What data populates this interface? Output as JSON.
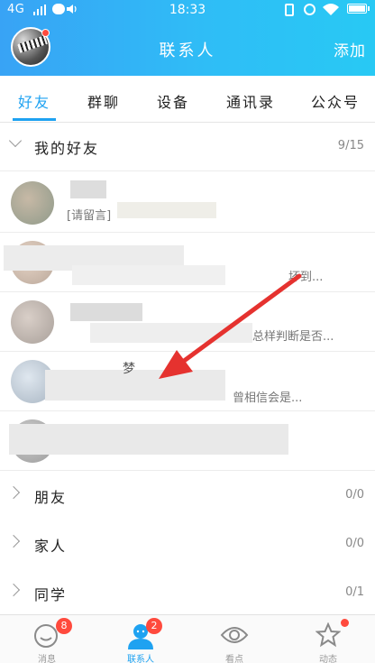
{
  "status_bar": {
    "network": "4G",
    "time": "18:33"
  },
  "header": {
    "title": "联系人",
    "add_label": "添加"
  },
  "tabs": [
    {
      "label": "好友",
      "active": true
    },
    {
      "label": "群聊"
    },
    {
      "label": "设备"
    },
    {
      "label": "通讯录"
    },
    {
      "label": "公众号"
    }
  ],
  "groups": [
    {
      "name": "我的好友",
      "count": "9/15",
      "expanded": true
    },
    {
      "name": "朋友",
      "count": "0/0"
    },
    {
      "name": "家人",
      "count": "0/0"
    },
    {
      "name": "同学",
      "count": "0/1"
    }
  ],
  "friends": [
    {
      "signature": "[请留言]"
    },
    {
      "signature": "坏到..."
    },
    {
      "signature": "总样判断是否..."
    },
    {
      "name_fragment": "梦",
      "signature": "曾相信会是..."
    },
    {
      "signature": ""
    }
  ],
  "bottom_nav": [
    {
      "label": "消息",
      "icon": "message-icon",
      "badge": "8"
    },
    {
      "label": "联系人",
      "icon": "contacts-icon",
      "badge": "2",
      "active": true
    },
    {
      "label": "看点",
      "icon": "eye-icon"
    },
    {
      "label": "动态",
      "icon": "star-icon",
      "dot": true
    }
  ],
  "colors": {
    "accent": "#1ea2f1",
    "badge": "#ff4a3d",
    "arrow": "#e5322f"
  }
}
